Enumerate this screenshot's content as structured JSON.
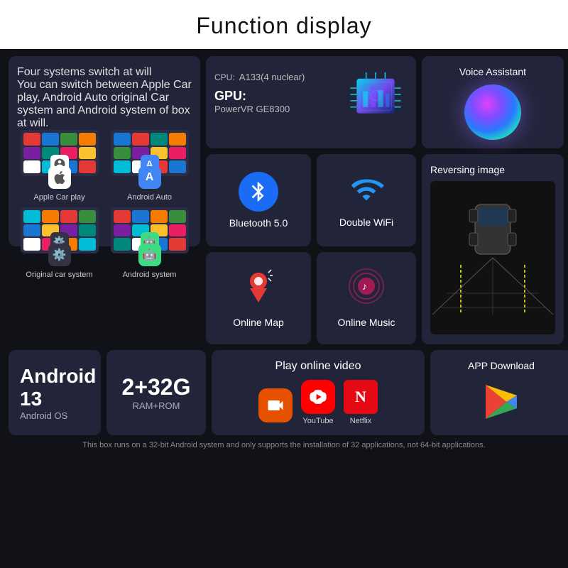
{
  "page": {
    "title": "Function display",
    "footer": "This box runs on a 32-bit Android system and only supports the installation of 32 applications, not 64-bit applications."
  },
  "systems": {
    "title": "Four systems switch at will",
    "desc": "You can switch between Apple Car play, Android Auto original Car system and Android system of box at will.",
    "items": [
      {
        "label": "Apple Car play",
        "badge": "🍎",
        "badge_type": "carplay"
      },
      {
        "label": "Android Auto",
        "badge": "A",
        "badge_type": "android_auto"
      },
      {
        "label": "Original car system",
        "badge": "⚙",
        "badge_type": "car_system"
      },
      {
        "label": "Android system",
        "badge": "🤖",
        "badge_type": "android"
      }
    ]
  },
  "cpu": {
    "label": "CPU:",
    "model": "A133(4 nuclear)",
    "gpu_label": "GPU:",
    "gpu_model": "PowerVR GE8300"
  },
  "voice": {
    "label": "Voice Assistant"
  },
  "bluetooth": {
    "label": "Bluetooth 5.0"
  },
  "wifi": {
    "label": "Double WiFi"
  },
  "reversing": {
    "label": "Reversing image"
  },
  "map": {
    "label": "Online Map"
  },
  "music": {
    "label": "Online Music"
  },
  "android13": {
    "title": "Android 13",
    "subtitle": "Android OS"
  },
  "ram": {
    "title": "2+32G",
    "subtitle": "RAM+ROM"
  },
  "video": {
    "title": "Play online video",
    "apps": [
      {
        "label": "",
        "type": "cam"
      },
      {
        "label": "YouTube",
        "type": "youtube"
      },
      {
        "label": "Netflix",
        "type": "netflix"
      }
    ]
  },
  "appdownload": {
    "label": "APP Download"
  }
}
